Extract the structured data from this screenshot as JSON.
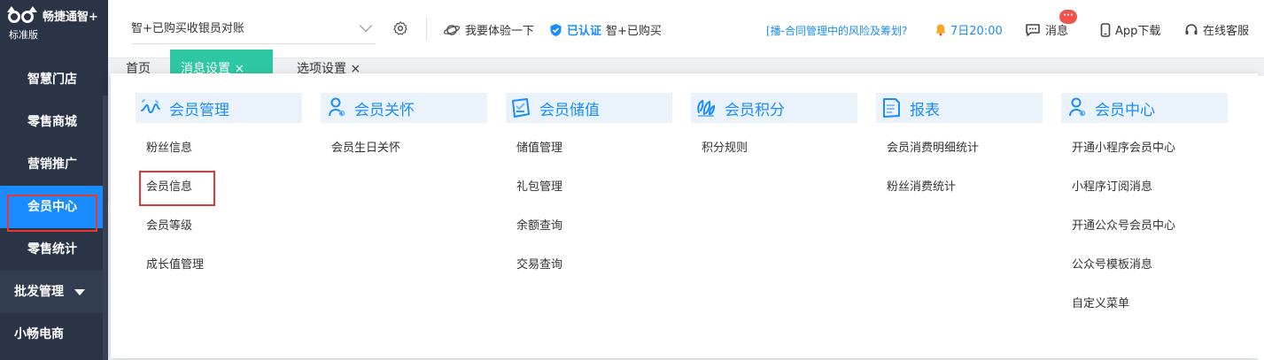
{
  "brand": {
    "name": "畅捷通智+",
    "edition": "标准版"
  },
  "sidebar": {
    "items": [
      {
        "label": "智慧门店"
      },
      {
        "label": "零售商城"
      },
      {
        "label": "营销推广"
      },
      {
        "label": "会员中心"
      },
      {
        "label": "零售统计"
      },
      {
        "label": "批发管理"
      },
      {
        "label": "小畅电商"
      }
    ]
  },
  "topbar": {
    "store_select": "智+已购买收银员对账",
    "try_label": "我要体验一下",
    "verified_label": "已认证",
    "plan_label": "智+已购买",
    "marquee": "[播-合同管理中的风险及筹划?",
    "alarm_time": "7日20:00",
    "badge": "···",
    "messages_label": "消息",
    "app_download_label": "App下载",
    "support_label": "在线客服"
  },
  "tabs": [
    {
      "label": "首页"
    },
    {
      "label": "消息设置 ×"
    },
    {
      "label": "选项设置 ×"
    }
  ],
  "menu": {
    "columns": [
      {
        "title": "会员管理",
        "icon": "member-manage-icon",
        "items": [
          "粉丝信息",
          "会员信息",
          "会员等级",
          "成长值管理"
        ]
      },
      {
        "title": "会员关怀",
        "icon": "member-care-icon",
        "items": [
          "会员生日关怀"
        ]
      },
      {
        "title": "会员储值",
        "icon": "stored-value-icon",
        "items": [
          "储值管理",
          "礼包管理",
          "余额查询",
          "交易查询"
        ]
      },
      {
        "title": "会员积分",
        "icon": "points-icon",
        "items": [
          "积分规则"
        ]
      },
      {
        "title": "报表",
        "icon": "report-icon",
        "items": [
          "会员消费明细统计",
          "粉丝消费统计"
        ]
      },
      {
        "title": "会员中心",
        "icon": "member-center-icon",
        "items": [
          "开通小程序会员中心",
          "小程序订阅消息",
          "开通公众号会员中心",
          "公众号模板消息",
          "自定义菜单"
        ]
      }
    ]
  },
  "colors": {
    "accent": "#1a8cff",
    "sidebar_bg": "#2b3446",
    "tab_active": "#2ec7a4",
    "highlight_box": "#e53935"
  }
}
